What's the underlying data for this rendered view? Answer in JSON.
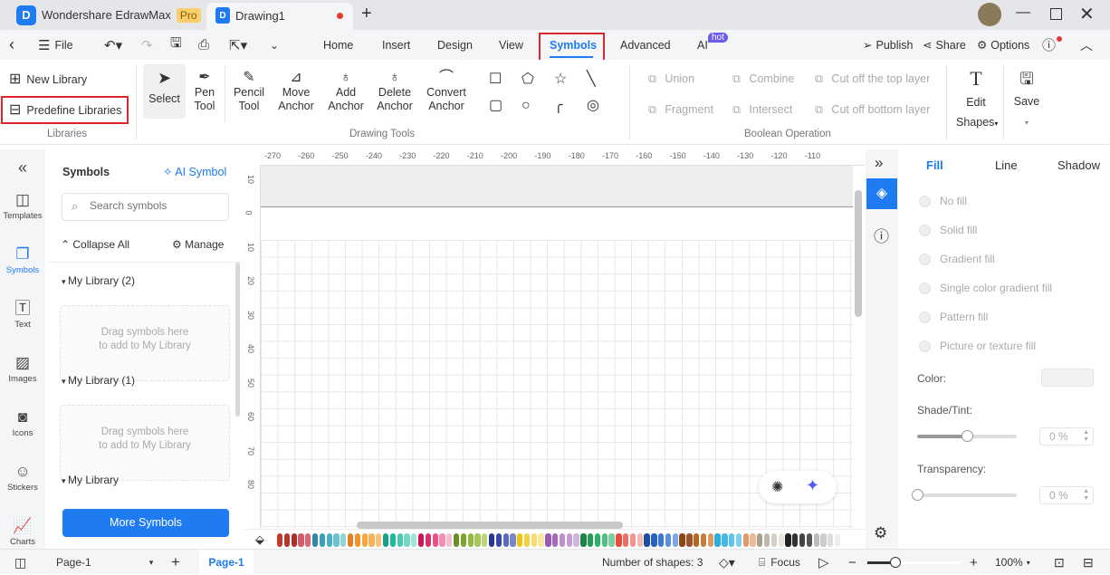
{
  "app": {
    "name": "Wondershare EdrawMax",
    "badge": "Pro",
    "doc_tab": "Drawing1",
    "colors": {
      "accent": "#1e7bf2",
      "highlight_box": "#e0262d",
      "hot": "#6c5ce7"
    }
  },
  "menu": {
    "file": "File",
    "tabs": [
      "Home",
      "Insert",
      "Design",
      "View",
      "Symbols",
      "Advanced",
      "AI"
    ],
    "active_tab": "Symbols",
    "ai_badge": "hot",
    "publish": "Publish",
    "share": "Share",
    "options": "Options"
  },
  "ribbon": {
    "libraries": {
      "new_library": "New Library",
      "predefine": "Predefine Libraries",
      "group": "Libraries"
    },
    "drawing": {
      "select": "Select",
      "pen": [
        "Pen",
        "Tool"
      ],
      "pencil": [
        "Pencil",
        "Tool"
      ],
      "move": [
        "Move",
        "Anchor"
      ],
      "add": [
        "Add",
        "Anchor"
      ],
      "delete": [
        "Delete",
        "Anchor"
      ],
      "convert": [
        "Convert",
        "Anchor"
      ],
      "group": "Drawing Tools"
    },
    "boolean": {
      "union": "Union",
      "combine": "Combine",
      "cut_top": "Cut off the top layer",
      "fragment": "Fragment",
      "intersect": "Intersect",
      "cut_bottom": "Cut off bottom layer",
      "group": "Boolean Operation"
    },
    "edit": [
      "Edit",
      "Shapes"
    ],
    "save": "Save"
  },
  "leftbar": [
    "Templates",
    "Symbols",
    "Text",
    "Images",
    "Icons",
    "Stickers",
    "Charts"
  ],
  "symbols": {
    "title": "Symbols",
    "ai_symbol": "AI Symbol",
    "search_placeholder": "Search symbols",
    "collapse": "Collapse All",
    "manage": "Manage",
    "libraries": [
      {
        "name": "My Library (2)",
        "drop": [
          "Drag symbols here",
          "to add to My Library"
        ]
      },
      {
        "name": "My Library (1)",
        "drop": [
          "Drag symbols here",
          "to add to My Library"
        ]
      },
      {
        "name": "My Library"
      }
    ],
    "more": "More Symbols"
  },
  "ruler": {
    "h": [
      "-270",
      "-260",
      "-250",
      "-240",
      "-230",
      "-220",
      "-210",
      "-200",
      "-190",
      "-180",
      "-170",
      "-160",
      "-150",
      "-140",
      "-130",
      "-120",
      "-110"
    ],
    "v": [
      "10",
      "0",
      "10",
      "20",
      "30",
      "40",
      "50",
      "60",
      "70",
      "80"
    ]
  },
  "palette": [
    "#c0392b",
    "#b03a2e",
    "#a93226",
    "#d35c6b",
    "#e06377",
    "#2e86ab",
    "#3aa0b5",
    "#48b0c2",
    "#6cc3cf",
    "#8fd3db",
    "#e67e22",
    "#f0932b",
    "#f5a742",
    "#f7b35b",
    "#f9c27a",
    "#16a085",
    "#1abc9c",
    "#48c9b0",
    "#76d7c4",
    "#a3e4d7",
    "#c2185b",
    "#d6336c",
    "#e75480",
    "#f48fb1",
    "#f8bbd0",
    "#6b8e23",
    "#7da42d",
    "#8fbc3b",
    "#a4c65a",
    "#bcd57a",
    "#283593",
    "#3949ab",
    "#5c6bc0",
    "#7986cb",
    "#f1c40f",
    "#f4d03f",
    "#f7dc6f",
    "#f9e79f",
    "#9b59b6",
    "#a569bd",
    "#bb8fce",
    "#c39bd3",
    "#d2b4de",
    "#1e8449",
    "#239b56",
    "#28b463",
    "#52be80",
    "#7dcea0",
    "#e74c3c",
    "#ec7063",
    "#f1948a",
    "#f5b7b1",
    "#1f4e9c",
    "#2a62c0",
    "#3a78d8",
    "#5b8fe0",
    "#7ba6e8",
    "#8b4513",
    "#a0522d",
    "#b5651d",
    "#c97b3d",
    "#dd9a5e",
    "#2eaadc",
    "#45b7e4",
    "#5cc4ec",
    "#7dd0f0",
    "#e59866",
    "#edbb99",
    "#a89f91",
    "#bfb8ab",
    "#d5cfc4",
    "#eae6df",
    "#222222",
    "#333333",
    "#444444",
    "#555555",
    "#bbbbbb",
    "#cccccc",
    "#dddddd",
    "#eeeeee"
  ],
  "right": {
    "tabs": [
      "Fill",
      "Line",
      "Shadow"
    ],
    "active": "Fill",
    "fills": [
      "No fill",
      "Solid fill",
      "Gradient fill",
      "Single color gradient fill",
      "Pattern fill",
      "Picture or texture fill"
    ],
    "color_label": "Color:",
    "shade_label": "Shade/Tint:",
    "shade_value": "0 %",
    "shade_level": 0.5,
    "transparency_label": "Transparency:",
    "transparency_value": "0 %",
    "transparency_level": 0
  },
  "status": {
    "page_select": "Page-1",
    "page_tab": "Page-1",
    "shapes": "Number of shapes: 3",
    "focus": "Focus",
    "zoom": "100%",
    "zoom_level": 0.1
  }
}
